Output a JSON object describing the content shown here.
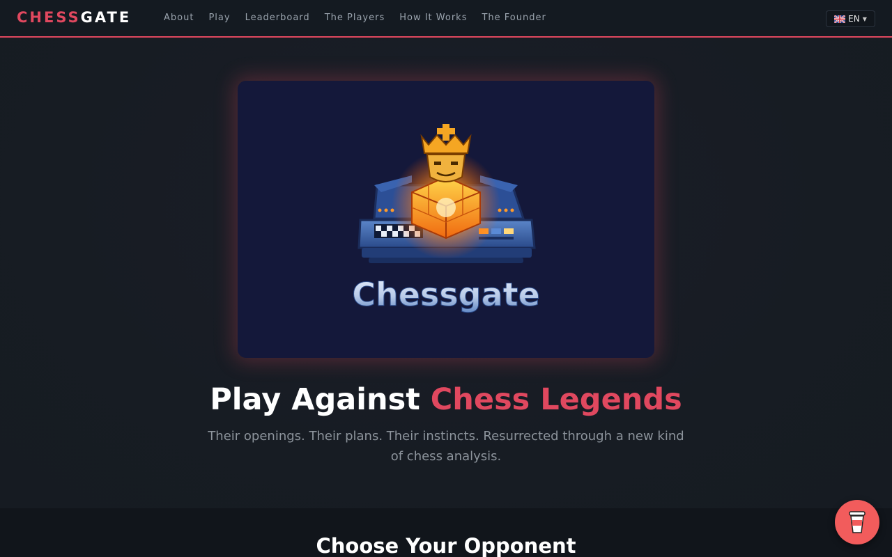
{
  "brand": {
    "part1": "CHESS",
    "part2": "GATE"
  },
  "nav": {
    "items": [
      {
        "label": "About"
      },
      {
        "label": "Play"
      },
      {
        "label": "Leaderboard"
      },
      {
        "label": "The Players"
      },
      {
        "label": "How It Works"
      },
      {
        "label": "The Founder"
      }
    ]
  },
  "language": {
    "code": "EN",
    "flag_icon": "uk-flag-icon"
  },
  "hero": {
    "logo_text": "Chessgate",
    "title_prefix": "Play Against ",
    "title_accent": "Chess Legends",
    "subtitle": "Their openings. Their plans. Their instincts. Resurrected through a new kind of chess analysis."
  },
  "section": {
    "title": "Choose Your Opponent"
  },
  "floating_button": {
    "icon": "coffee-cup-icon"
  },
  "colors": {
    "accent": "#e0485f",
    "background": "#171c23",
    "nav_background": "#141a21",
    "card_background": "#14183a",
    "coffee_button": "#f25c5c"
  }
}
